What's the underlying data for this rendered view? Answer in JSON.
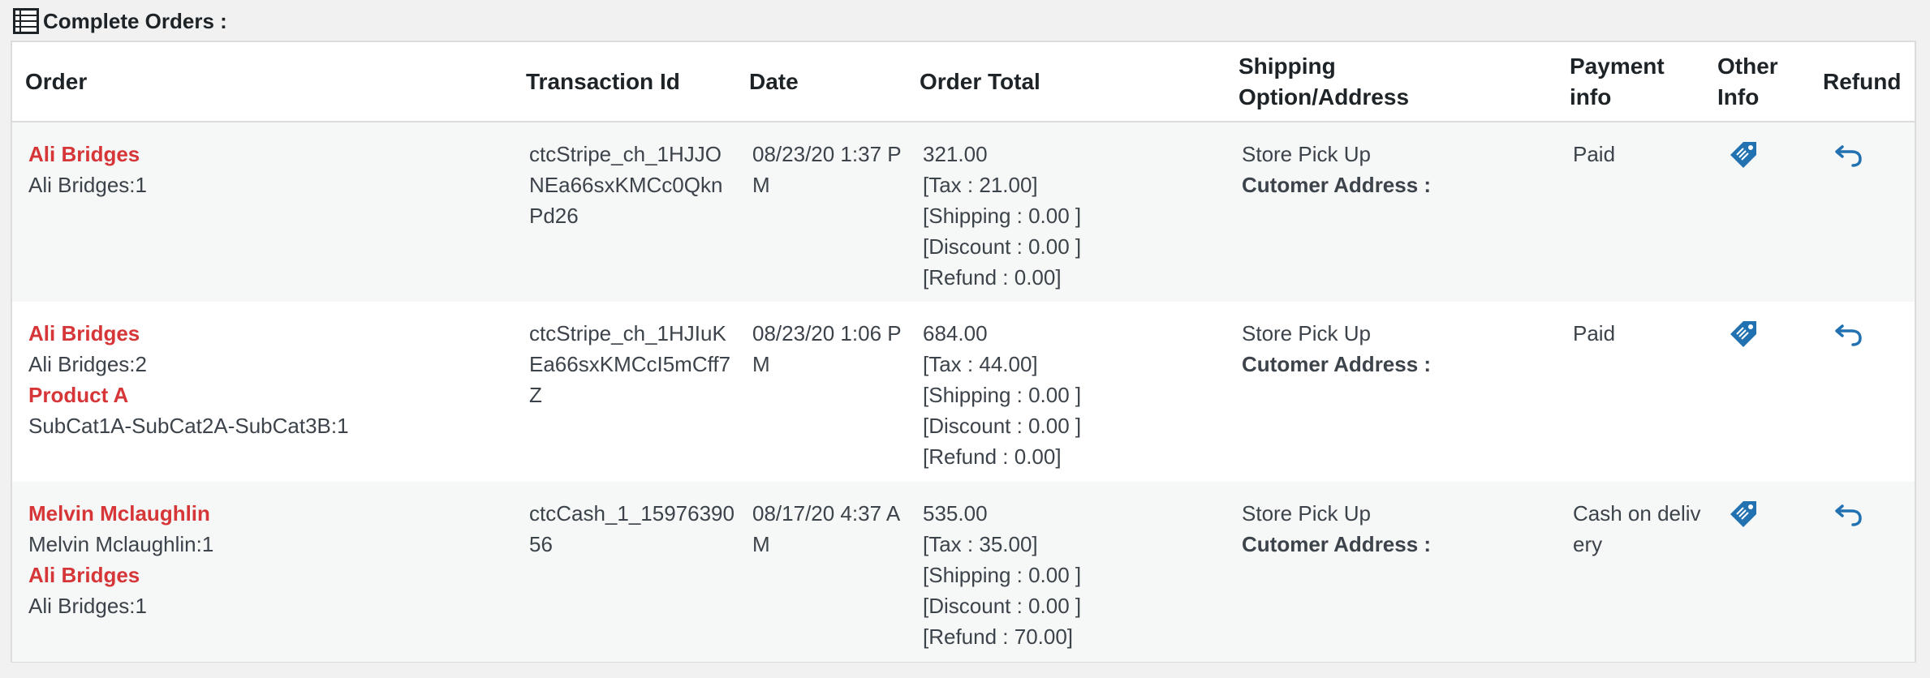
{
  "page": {
    "title": "Complete Orders :"
  },
  "icons": {
    "heading": "list-icon",
    "other_info": "tag-ticket-icon",
    "refund": "undo-arrow-icon"
  },
  "colors": {
    "item_name": "#d63638",
    "icon_blue": "#2271b1"
  },
  "columns": {
    "order": "Order",
    "transaction": "Transaction Id",
    "date": "Date",
    "total": "Order Total",
    "shipping_1": "Shipping",
    "shipping_2": "Option/Address",
    "payment_1": "Payment",
    "payment_2": "info",
    "other_1": "Other",
    "other_2": "Info",
    "refund": "Refund"
  },
  "orders": [
    {
      "items": [
        {
          "name": "Ali Bridges",
          "detail": "Ali Bridges:1"
        }
      ],
      "transaction_id": "ctcStripe_ch_1HJJONEa66sxKMCc0QknPd26",
      "date": "08/23/20 1:37 PM",
      "total": "321.00",
      "tax": "[Tax : 21.00]",
      "shipping": "[Shipping : 0.00 ]",
      "discount": "[Discount : 0.00 ]",
      "refund_amount": "[Refund : 0.00]",
      "shipping_option": "Store Pick Up",
      "address_label": "Cutomer Address :",
      "payment": "Paid"
    },
    {
      "items": [
        {
          "name": "Ali Bridges",
          "detail": "Ali Bridges:2"
        },
        {
          "name": "Product A",
          "detail": "SubCat1A-SubCat2A-SubCat3B:1"
        }
      ],
      "transaction_id": "ctcStripe_ch_1HJIuKEa66sxKMCcI5mCff7Z",
      "date": "08/23/20 1:06 PM",
      "total": "684.00",
      "tax": "[Tax : 44.00]",
      "shipping": "[Shipping : 0.00 ]",
      "discount": "[Discount : 0.00 ]",
      "refund_amount": "[Refund : 0.00]",
      "shipping_option": "Store Pick Up",
      "address_label": "Cutomer Address :",
      "payment": "Paid"
    },
    {
      "items": [
        {
          "name": "Melvin Mclaughlin",
          "detail": "Melvin Mclaughlin:1"
        },
        {
          "name": "Ali Bridges",
          "detail": "Ali Bridges:1"
        }
      ],
      "transaction_id": "ctcCash_1_1597639056",
      "date": "08/17/20 4:37 AM",
      "total": "535.00",
      "tax": "[Tax : 35.00]",
      "shipping": "[Shipping : 0.00 ]",
      "discount": "[Discount : 0.00 ]",
      "refund_amount": "[Refund : 70.00]",
      "shipping_option": "Store Pick Up",
      "address_label": "Cutomer Address :",
      "payment": "Cash on delivery"
    }
  ]
}
